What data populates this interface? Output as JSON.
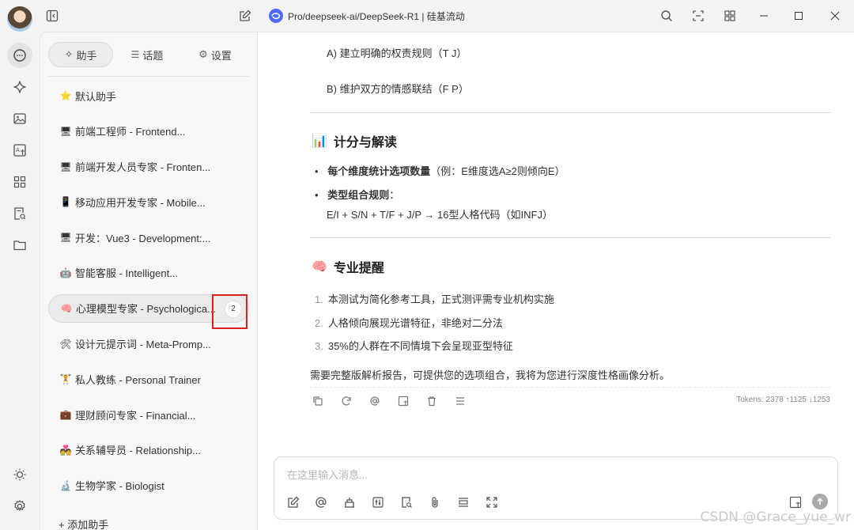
{
  "window": {
    "title": "Pro/deepseek-ai/DeepSeek-R1 | 硅基流动"
  },
  "panel": {
    "tabs": [
      {
        "label": "助手",
        "icon": "sparkle-icon"
      },
      {
        "label": "话题",
        "icon": "list-icon"
      },
      {
        "label": "设置",
        "icon": "gear-icon"
      }
    ],
    "items": [
      {
        "emoji": "⭐",
        "label": "默认助手"
      },
      {
        "emoji": "🖥",
        "label": "前端工程师 - Frontend..."
      },
      {
        "emoji": "🖥",
        "label": "前端开发人员专家 - Fronten..."
      },
      {
        "emoji": "📱",
        "label": "移动应用开发专家 - Mobile..."
      },
      {
        "emoji": "🖥",
        "label": "开发：Vue3 - Development:..."
      },
      {
        "emoji": "🤖",
        "label": "智能客服 - Intelligent..."
      },
      {
        "emoji": "🧠",
        "label": "心理模型专家 - Psychologica...",
        "badge": "2"
      },
      {
        "emoji": "🛠",
        "label": "设计元提示词 - Meta-Promp..."
      },
      {
        "emoji": "🏋",
        "label": "私人教练 - Personal Trainer"
      },
      {
        "emoji": "💼",
        "label": "理财顾问专家 - Financial..."
      },
      {
        "emoji": "💑",
        "label": "关系辅导员 - Relationship..."
      },
      {
        "emoji": "🔬",
        "label": "生物学家 - Biologist"
      }
    ],
    "add_label": "+ 添加助手"
  },
  "main": {
    "option_a": "A) 建立明确的权责规则（T J）",
    "option_b": "B) 维护双方的情感联结（F P）",
    "section1": {
      "emoji": "📊",
      "title": "计分与解读",
      "bullet1_bold": "每个维度统计选项数量",
      "bullet1_rest": "（例：E维度选A≥2则倾向E）",
      "bullet2_bold": "类型组合规则",
      "bullet2_colon": "：",
      "bullet2_line2": "E/I + S/N + T/F + J/P → 16型人格代码（如INFJ）"
    },
    "section2": {
      "emoji": "🧠",
      "title": "专业提醒",
      "items": [
        {
          "num": "1.",
          "text": "本测试为简化参考工具，正式测评需专业机构实施"
        },
        {
          "num": "2.",
          "text": "人格倾向展现光谱特征，非绝对二分法"
        },
        {
          "num": "3.",
          "text": "35%的人群在不同情境下会呈现亚型特征"
        }
      ]
    },
    "closing": "需要完整版解析报告，可提供您的选项组合，我将为您进行深度性格画像分析。",
    "tokens": "Tokens: 2378 ↑1125 ↓1253"
  },
  "composer": {
    "placeholder": "在这里输入消息..."
  },
  "watermark": "CSDN @Grace_yue_wr"
}
